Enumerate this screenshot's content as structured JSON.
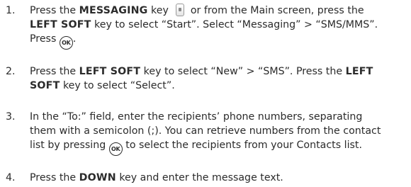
{
  "steps": [
    {
      "number": "1.",
      "lines": [
        [
          "Press the ",
          {
            "b": "MESSAGING"
          },
          " key ",
          {
            "icon": "messaging-key-icon"
          },
          " or from the Main screen, press the"
        ],
        [
          {
            "b": "LEFT SOFT"
          },
          " key to select “Start”. Select “Messaging” > “SMS/MMS”."
        ],
        [
          "Press ",
          {
            "icon": "ok-key-icon",
            "label": "OK"
          },
          "."
        ]
      ]
    },
    {
      "number": "2.",
      "lines": [
        [
          "Press the ",
          {
            "b": "LEFT SOFT"
          },
          " key to select “New” > “SMS”.  Press the ",
          {
            "b": "LEFT"
          }
        ],
        [
          {
            "b": "SOFT"
          },
          " key to select “Select”."
        ]
      ]
    },
    {
      "number": "3.",
      "lines": [
        [
          "In the “To:” field, enter the recipients’ phone numbers, separating"
        ],
        [
          "them with a semicolon (;). You can retrieve numbers from the contact"
        ],
        [
          "list by pressing ",
          {
            "icon": "ok-key-icon",
            "label": "OK"
          },
          " to select the recipients from your Contacts list."
        ]
      ]
    },
    {
      "number": "4.",
      "lines": [
        [
          "Press the ",
          {
            "b": "DOWN"
          },
          " key and enter the message text."
        ]
      ]
    }
  ]
}
